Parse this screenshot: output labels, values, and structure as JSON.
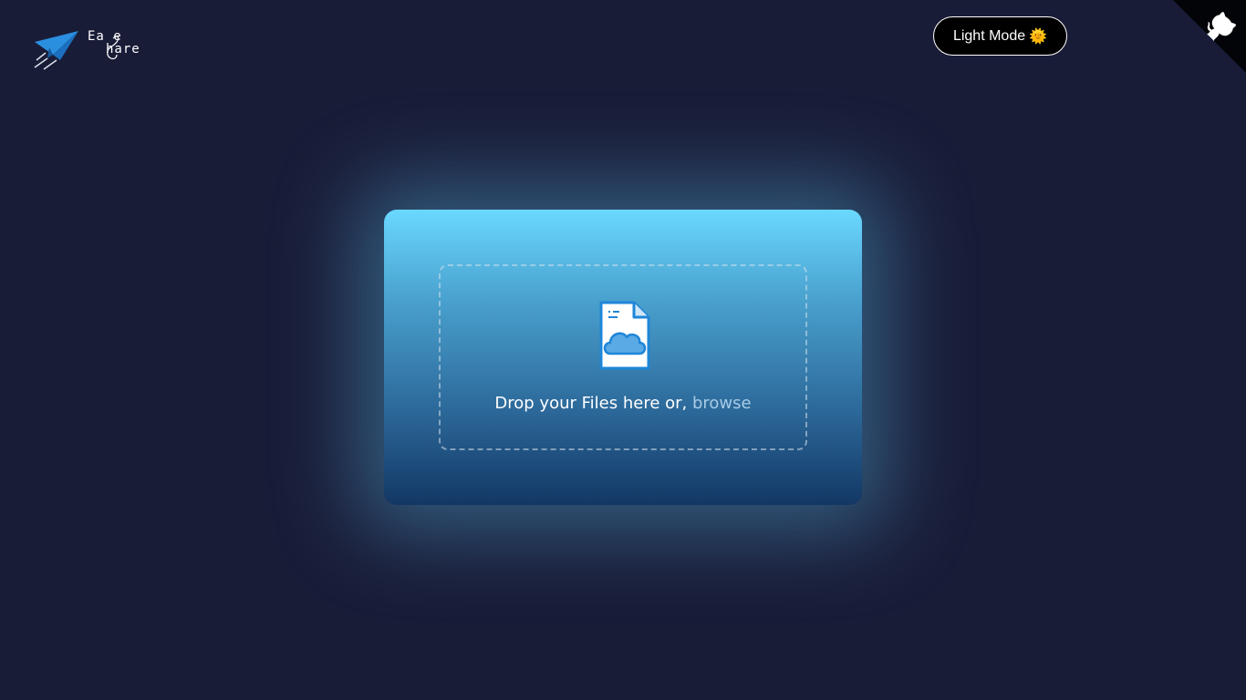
{
  "logo": {
    "word_top": "Ea e",
    "word_bottom": "hare",
    "icon": "paper-plane-icon"
  },
  "theme_toggle": {
    "label": "Light Mode",
    "icon": "sun-icon",
    "icon_glyph": "🌞"
  },
  "github_corner": {
    "icon": "github-octocat-icon"
  },
  "upload": {
    "icon": "file-cloud-upload-icon",
    "prompt": "Drop your Files here or,",
    "browse_label": "browse"
  },
  "colors": {
    "background": "#191c37",
    "card_top": "#6ad8ff",
    "card_bottom": "#133765",
    "browse": "#a8cbe6",
    "icon_blue": "#1f86d8"
  }
}
